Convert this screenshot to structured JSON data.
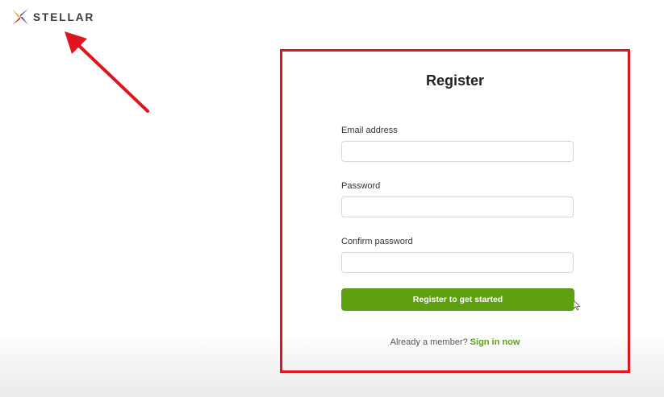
{
  "brand": {
    "name": "STELLAR",
    "logo_icon": "star-logo-icon"
  },
  "annotation": {
    "arrow_color": "#e0141c",
    "highlight_color": "#e0141c"
  },
  "form": {
    "title": "Register",
    "email": {
      "label": "Email address",
      "value": "",
      "placeholder": ""
    },
    "password": {
      "label": "Password",
      "value": "",
      "placeholder": ""
    },
    "confirm_password": {
      "label": "Confirm password",
      "value": "",
      "placeholder": ""
    },
    "submit_label": "Register to get started",
    "footer_text": "Already a member?",
    "footer_link": "Sign in now"
  },
  "colors": {
    "accent": "#5ea010"
  }
}
